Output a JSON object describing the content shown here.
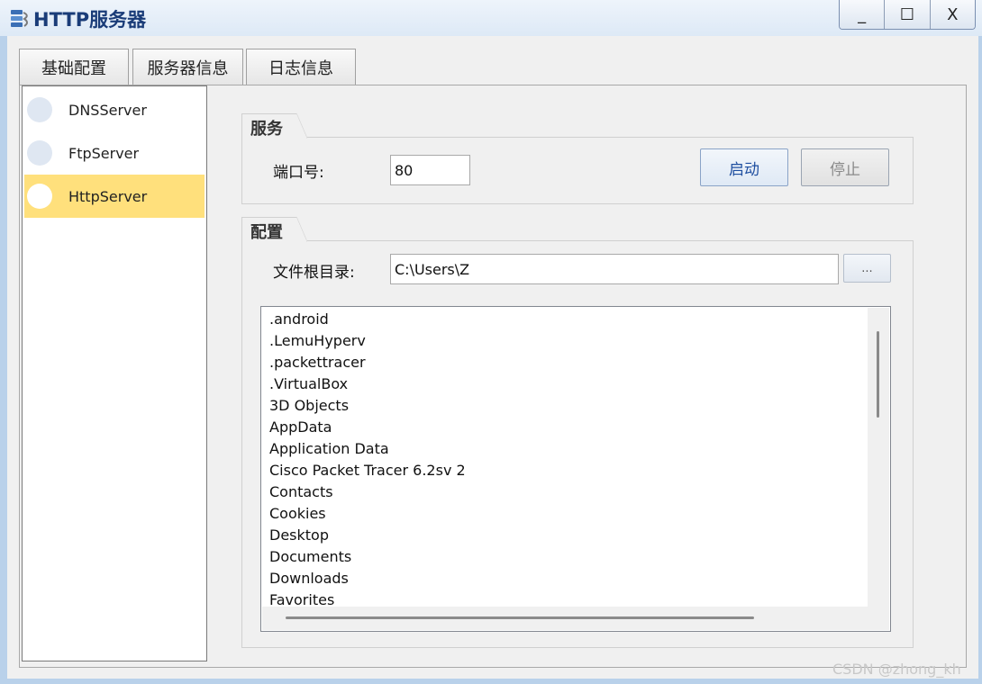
{
  "window": {
    "title": "HTTP服务器",
    "controls": {
      "minimize": "_",
      "maximize": "☐",
      "close": "X"
    }
  },
  "tabs": [
    {
      "label": "基础配置",
      "active": false
    },
    {
      "label": "服务器信息",
      "active": false
    },
    {
      "label": "日志信息",
      "active": false
    }
  ],
  "servers": [
    {
      "label": "DNSServer",
      "selected": false
    },
    {
      "label": "FtpServer",
      "selected": false
    },
    {
      "label": "HttpServer",
      "selected": true
    }
  ],
  "service_group": {
    "title": "服务",
    "port_label": "端口号:",
    "port_value": "80",
    "start_label": "启动",
    "stop_label": "停止"
  },
  "config_group": {
    "title": "配置",
    "root_label": "文件根目录:",
    "root_value": "C:\\Users\\Z",
    "browse_label": "..."
  },
  "files": [
    ".android",
    ".LemuHyperv",
    ".packettracer",
    ".VirtualBox",
    "3D Objects",
    "AppData",
    "Application Data",
    "Cisco Packet Tracer 6.2sv 2",
    "Contacts",
    "Cookies",
    "Desktop",
    "Documents",
    "Downloads",
    "Favorites"
  ],
  "watermark": "CSDN @zhong_kh",
  "colors": {
    "selected_item": "#ffe07c",
    "title_text": "#1a3c78",
    "start_text": "#1f4fa0"
  }
}
